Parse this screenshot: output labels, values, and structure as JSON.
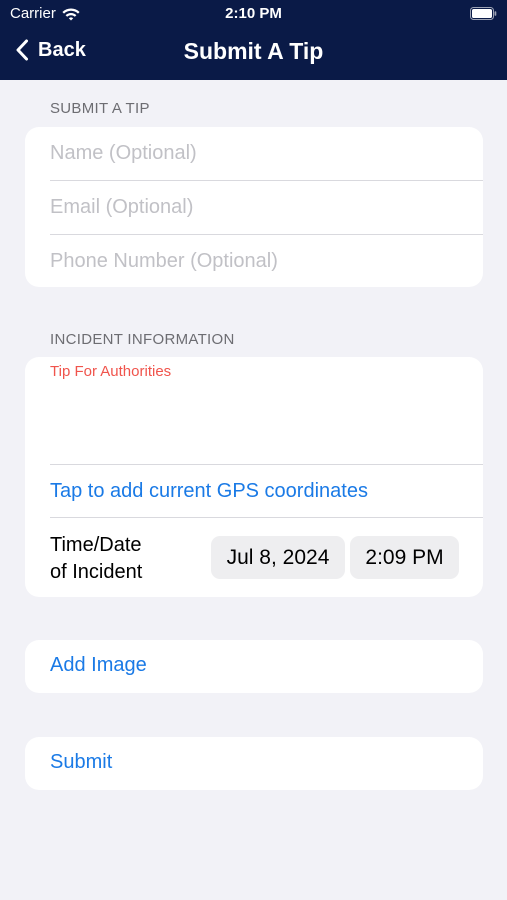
{
  "status_bar": {
    "carrier": "Carrier",
    "time": "2:10 PM"
  },
  "nav": {
    "back_label": "Back",
    "title": "Submit A Tip"
  },
  "sections": {
    "submit_tip_header": "SUBMIT A TIP",
    "incident_header": "INCIDENT INFORMATION"
  },
  "form": {
    "name_placeholder": "Name (Optional)",
    "email_placeholder": "Email (Optional)",
    "phone_placeholder": "Phone Number (Optional)"
  },
  "incident": {
    "tip_label": "Tip For Authorities",
    "gps_link": "Tap to add current GPS coordinates",
    "datetime_label_line1": "Time/Date",
    "datetime_label_line2": "of Incident",
    "date_value": "Jul 8, 2024",
    "time_value": "2:09 PM"
  },
  "actions": {
    "add_image": "Add Image",
    "submit": "Submit"
  },
  "colors": {
    "header_bg": "#0a1a47",
    "link": "#1a7ae6",
    "tip_label": "#f0544c",
    "background": "#f2f2f7"
  }
}
